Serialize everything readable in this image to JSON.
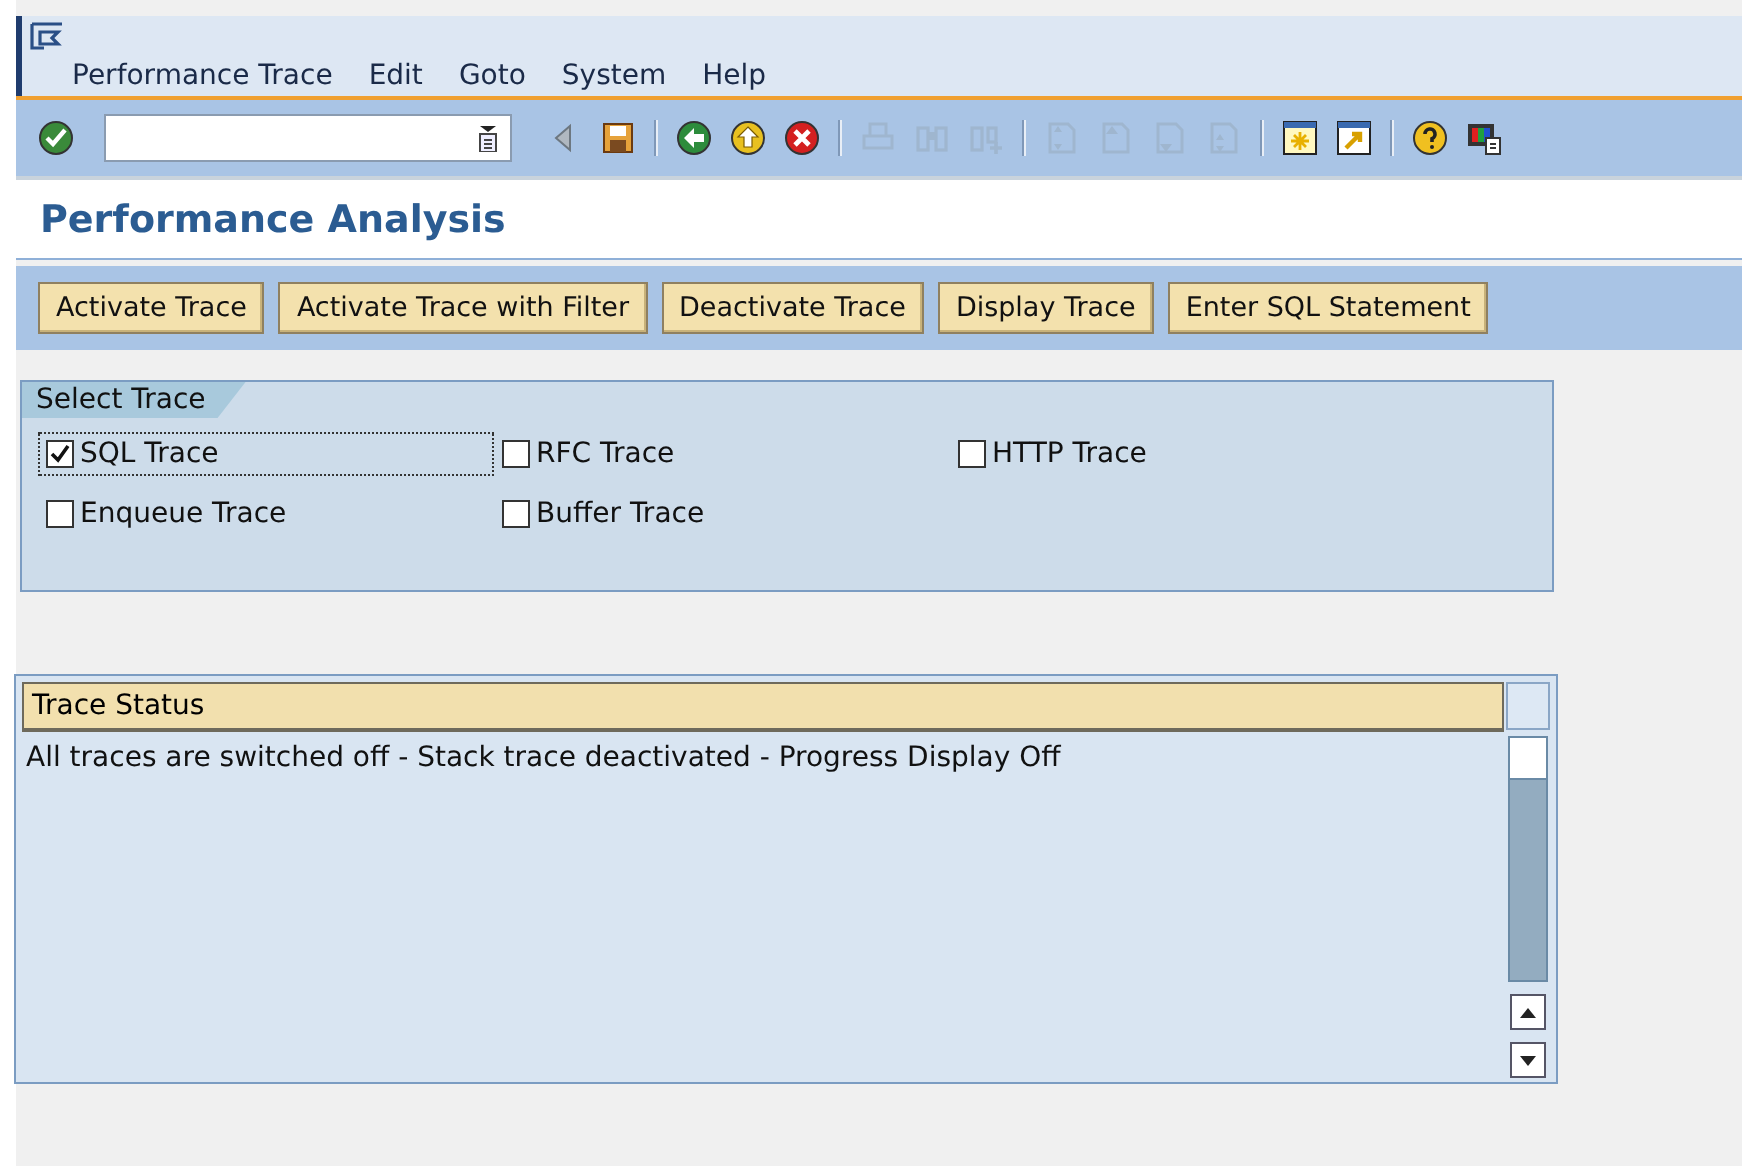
{
  "menu": [
    "Performance Trace",
    "Edit",
    "Goto",
    "System",
    "Help"
  ],
  "toolbar": [
    {
      "kind": "enter",
      "disabled": false
    },
    {
      "kind": "command-field",
      "disabled": false
    },
    {
      "kind": "previous",
      "disabled": true
    },
    {
      "kind": "save",
      "disabled": false
    },
    {
      "kind": "separator"
    },
    {
      "kind": "back",
      "disabled": false
    },
    {
      "kind": "exit",
      "disabled": false
    },
    {
      "kind": "cancel",
      "disabled": false
    },
    {
      "kind": "separator"
    },
    {
      "kind": "print",
      "disabled": true
    },
    {
      "kind": "find",
      "disabled": true
    },
    {
      "kind": "find-next",
      "disabled": true
    },
    {
      "kind": "separator"
    },
    {
      "kind": "first-page",
      "disabled": true
    },
    {
      "kind": "previous-page",
      "disabled": true
    },
    {
      "kind": "next-page",
      "disabled": true
    },
    {
      "kind": "last-page",
      "disabled": true
    },
    {
      "kind": "separator"
    },
    {
      "kind": "new-session",
      "disabled": false
    },
    {
      "kind": "shortcut",
      "disabled": false
    },
    {
      "kind": "separator"
    },
    {
      "kind": "help",
      "disabled": false
    },
    {
      "kind": "layout",
      "disabled": false
    }
  ],
  "title": "Performance Analysis",
  "app_buttons": [
    "Activate Trace",
    "Activate Trace with Filter",
    "Deactivate Trace",
    "Display Trace",
    "Enter SQL Statement"
  ],
  "select_trace": {
    "title": "Select Trace",
    "options": [
      {
        "label": "SQL Trace",
        "checked": true,
        "focused": true
      },
      {
        "label": "RFC Trace",
        "checked": false,
        "focused": false
      },
      {
        "label": "HTTP Trace",
        "checked": false,
        "focused": false
      },
      {
        "label": "Enqueue Trace",
        "checked": false,
        "focused": false
      },
      {
        "label": "Buffer Trace",
        "checked": false,
        "focused": false
      }
    ]
  },
  "trace_status": {
    "columns": [
      "Trace Status"
    ],
    "rows": [
      "All traces are switched off - Stack trace deactivated - Progress Display Off"
    ]
  }
}
